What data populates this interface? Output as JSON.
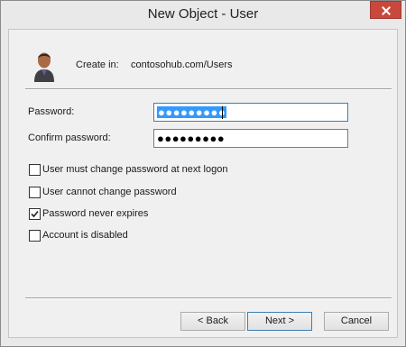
{
  "window": {
    "title": "New Object - User"
  },
  "header": {
    "create_in_label": "Create in:",
    "create_in_value": "contosohub.com/Users"
  },
  "password": {
    "label": "Password:",
    "masked_value": "●●●●●●●●●"
  },
  "confirm_password": {
    "label": "Confirm password:",
    "masked_value": "●●●●●●●●●"
  },
  "options": [
    {
      "label": "User must change password at next logon",
      "checked": false
    },
    {
      "label": "User cannot change password",
      "checked": false
    },
    {
      "label": "Password never expires",
      "checked": true
    },
    {
      "label": "Account is disabled",
      "checked": false
    }
  ],
  "buttons": {
    "back": "< Back",
    "next": "Next >",
    "cancel": "Cancel"
  }
}
